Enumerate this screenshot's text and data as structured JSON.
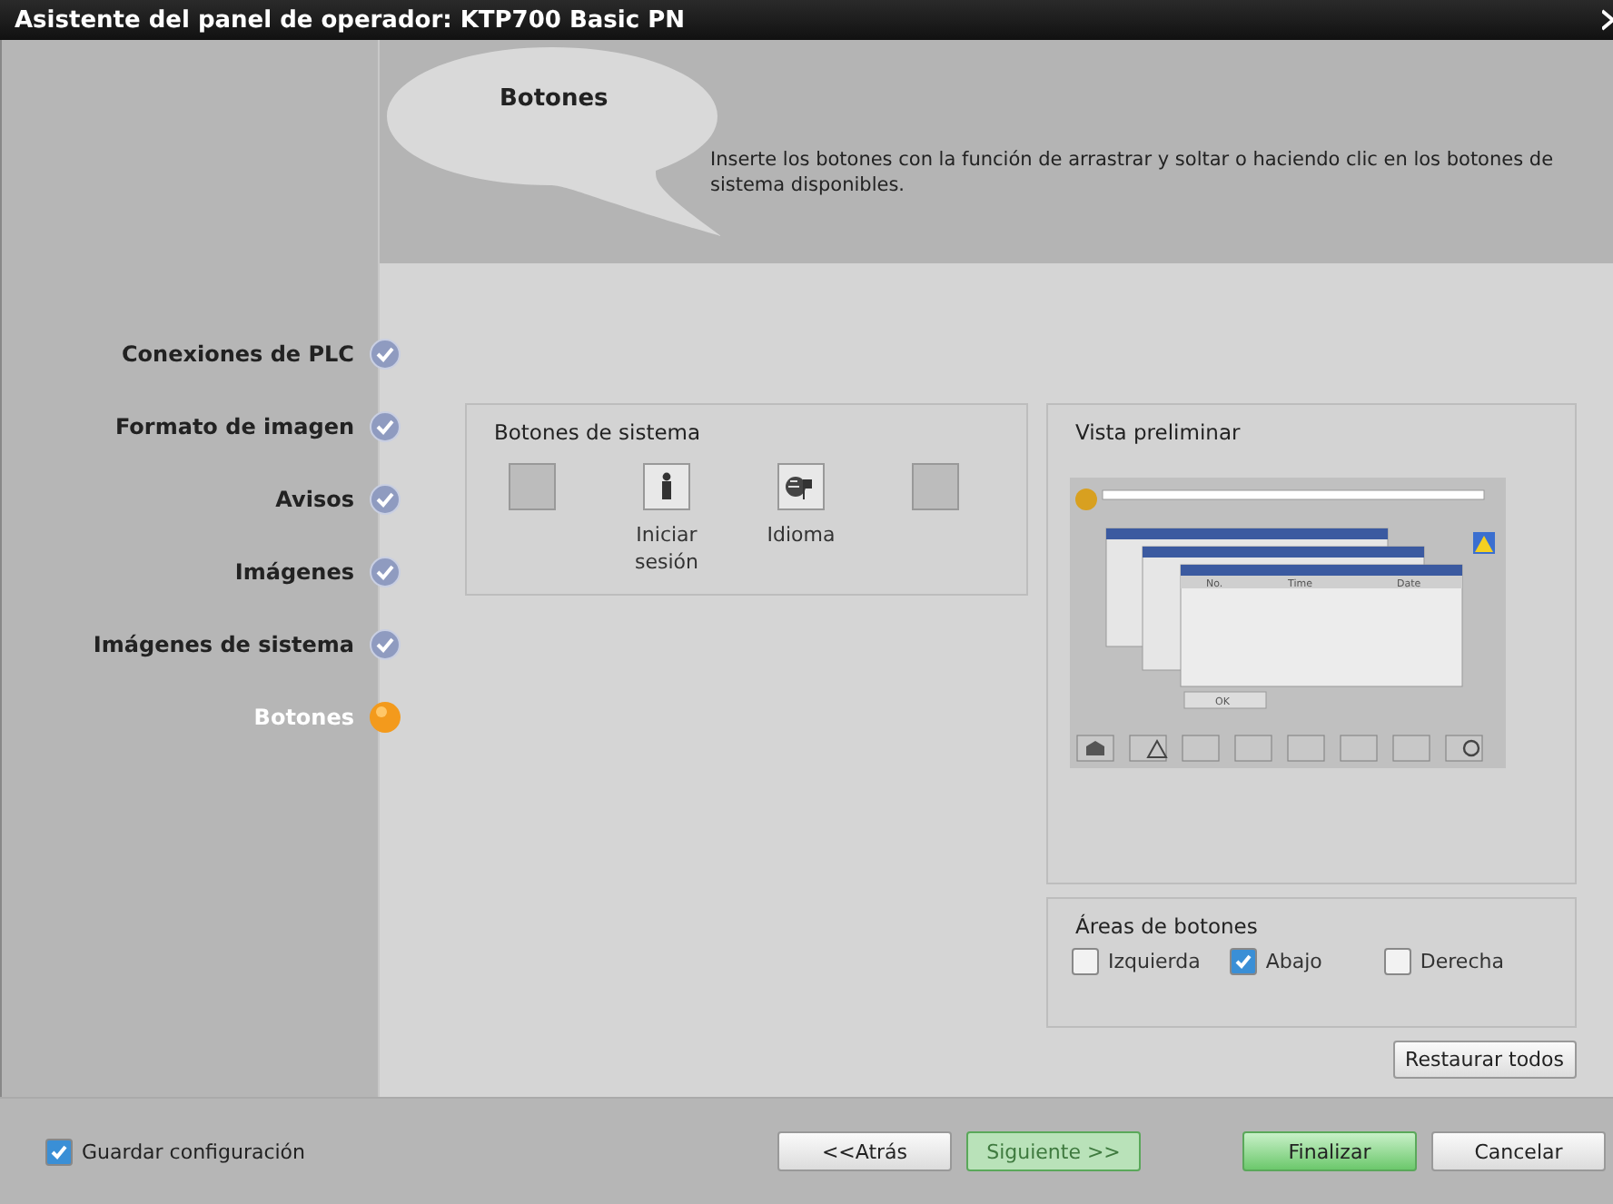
{
  "window": {
    "title": "Asistente del panel de operador: KTP700 Basic PN"
  },
  "header": {
    "title": "Botones",
    "description": "Inserte los botones con la función de arrastrar y soltar o haciendo clic en los botones de sistema disponibles."
  },
  "steps": [
    {
      "label": "Conexiones de PLC",
      "kind": "done",
      "selected": false
    },
    {
      "label": "Formato de imagen",
      "kind": "done",
      "selected": false
    },
    {
      "label": "Avisos",
      "kind": "done",
      "selected": false
    },
    {
      "label": "Imágenes",
      "kind": "done",
      "selected": false
    },
    {
      "label": "Imágenes de sistema",
      "kind": "done",
      "selected": false
    },
    {
      "label": "Botones",
      "kind": "current",
      "selected": true
    }
  ],
  "system_buttons": {
    "title": "Botones de sistema",
    "items": [
      {
        "kind": "empty"
      },
      {
        "kind": "login",
        "label": "Iniciar sesión"
      },
      {
        "kind": "language",
        "label": "Idioma"
      },
      {
        "kind": "empty"
      }
    ]
  },
  "preview": {
    "title": "Vista preliminar",
    "columns": [
      "No.",
      "Time",
      "Date"
    ],
    "ok_label": "OK"
  },
  "button_areas": {
    "title": "Áreas de botones",
    "options": [
      {
        "label": "Izquierda",
        "checked": false
      },
      {
        "label": "Abajo",
        "checked": true
      },
      {
        "label": "Derecha",
        "checked": false
      }
    ]
  },
  "restore_button": "Restaurar todos",
  "save_config": {
    "label": "Guardar configuración",
    "checked": true
  },
  "nav_buttons": [
    {
      "label": "<<Atrás",
      "kind": "normal",
      "disabled": false
    },
    {
      "label": "Siguiente >>",
      "kind": "primary",
      "disabled": true
    },
    {
      "label": "Finalizar",
      "kind": "primary",
      "disabled": false
    },
    {
      "label": "Cancelar",
      "kind": "normal",
      "disabled": false
    }
  ]
}
